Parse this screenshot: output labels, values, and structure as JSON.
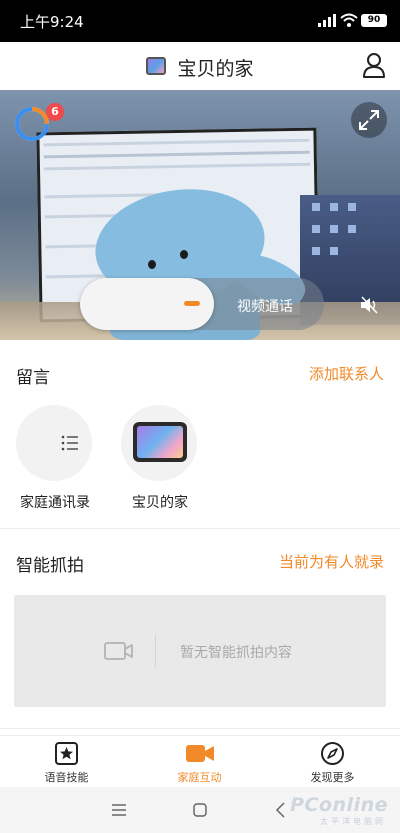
{
  "status_bar": {
    "time": "上午9:24",
    "battery": "90"
  },
  "header": {
    "title": "宝贝的家",
    "device_icon": "tablet-icon",
    "user_icon": "user-icon"
  },
  "video": {
    "notification_count": "6",
    "call_label": "视频通话",
    "icons": [
      "expand-icon",
      "mute-icon",
      "progress-ring-icon"
    ]
  },
  "messages": {
    "title": "留言",
    "add_contact": "添加联系人",
    "contacts": [
      {
        "label": "家庭通讯录",
        "icon": "list-icon"
      },
      {
        "label": "宝贝的家",
        "icon": "tablet-icon"
      }
    ]
  },
  "smart_capture": {
    "title": "智能抓拍",
    "mode_link": "当前为有人就录",
    "empty_text": "暂无智能抓拍内容",
    "icon": "video-camera-icon"
  },
  "bottom_nav": {
    "items": [
      {
        "label": "语音技能",
        "icon": "star-box-icon",
        "active": false
      },
      {
        "label": "家庭互动",
        "icon": "video-camera-icon",
        "active": true
      },
      {
        "label": "发现更多",
        "icon": "compass-icon",
        "active": false
      }
    ]
  },
  "watermark": {
    "brand": "PConline",
    "tagline": "太平洋电脑网"
  },
  "colors": {
    "accent": "#f28a2a",
    "badge": "#f04a4a",
    "status_bar": "#000000"
  }
}
